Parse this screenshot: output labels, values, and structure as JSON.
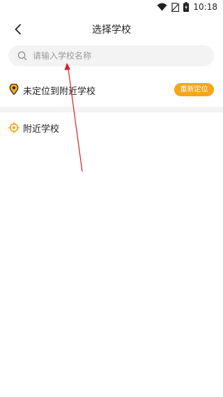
{
  "status_bar": {
    "time": "10:18"
  },
  "nav": {
    "title": "选择学校"
  },
  "search": {
    "placeholder": "请输入学校名称",
    "value": ""
  },
  "location": {
    "status": "未定位到附近学校",
    "relocate_label": "重新定位"
  },
  "nearby": {
    "heading": "附近学校"
  },
  "colors": {
    "accent": "#f7a51a",
    "annotation": "#d82020"
  },
  "icons": {
    "status": [
      "wifi-icon",
      "no-sim-icon",
      "battery-icon"
    ],
    "nav": "back-arrow-icon",
    "search": "search-icon",
    "location": "map-pin-icon",
    "nearby": "location-target-icon"
  }
}
